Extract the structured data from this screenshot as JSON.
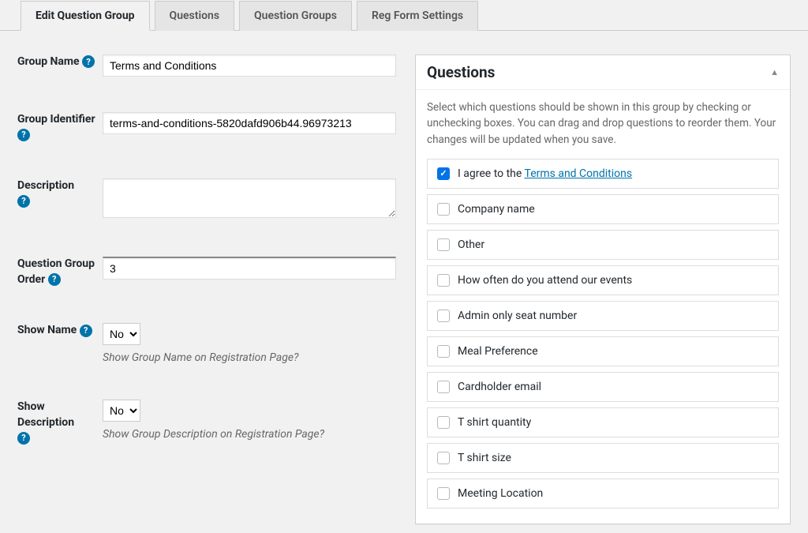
{
  "tabs": {
    "edit": "Edit Question Group",
    "questions": "Questions",
    "groups": "Question Groups",
    "regform": "Reg Form Settings"
  },
  "form": {
    "group_name_label": "Group Name",
    "group_name_value": "Terms and Conditions",
    "group_identifier_label": "Group Identifier",
    "group_identifier_value": "terms-and-conditions-5820dafd906b44.96973213",
    "description_label": "Description",
    "description_value": "",
    "order_label": "Question Group Order",
    "order_value": "3",
    "show_name_label": "Show Name",
    "show_name_value": "No",
    "show_name_hint": "Show Group Name on Registration Page?",
    "show_desc_label": "Show Description",
    "show_desc_value": "No",
    "show_desc_hint": "Show Group Description on Registration Page?"
  },
  "panel": {
    "title": "Questions",
    "desc": "Select which questions should be shown in this group by checking or unchecking boxes. You can drag and drop questions to reorder them. Your changes will be updated when you save."
  },
  "questions": [
    {
      "checked": true,
      "prefix": "I agree to the ",
      "link": "Terms and Conditions"
    },
    {
      "checked": false,
      "label": "Company name"
    },
    {
      "checked": false,
      "label": "Other"
    },
    {
      "checked": false,
      "label": "How often do you attend our events"
    },
    {
      "checked": false,
      "label": "Admin only seat number"
    },
    {
      "checked": false,
      "label": "Meal Preference"
    },
    {
      "checked": false,
      "label": "Cardholder email"
    },
    {
      "checked": false,
      "label": "T shirt quantity"
    },
    {
      "checked": false,
      "label": "T shirt size"
    },
    {
      "checked": false,
      "label": "Meeting Location"
    }
  ]
}
